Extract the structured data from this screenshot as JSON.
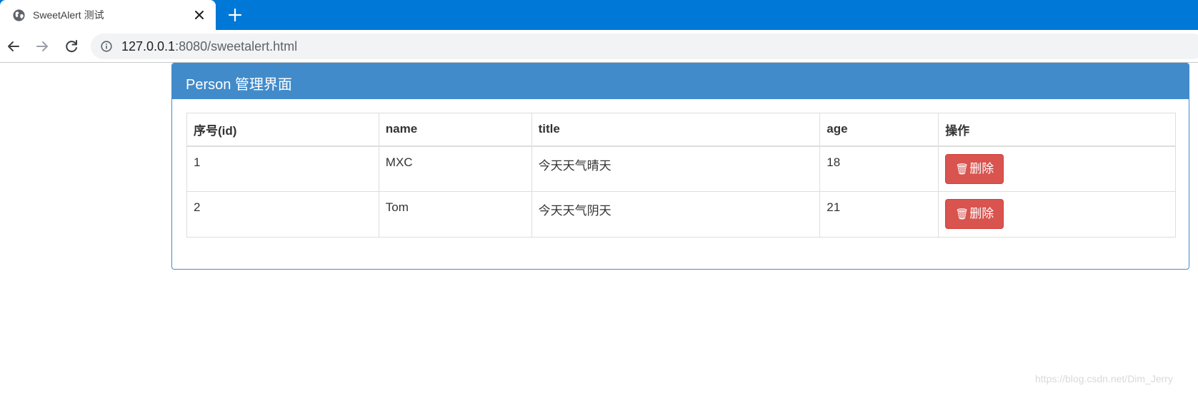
{
  "browser": {
    "tab_title": "SweetAlert 测试",
    "url_host": "127.0.0.1",
    "url_rest": ":8080/sweetalert.html"
  },
  "panel": {
    "title": "Person 管理界面"
  },
  "table": {
    "headers": [
      "序号(id)",
      "name",
      "title",
      "age",
      "操作"
    ],
    "rows": [
      {
        "id": "1",
        "name": "MXC",
        "title": "今天天气晴天",
        "age": "18",
        "action_label": "删除"
      },
      {
        "id": "2",
        "name": "Tom",
        "title": "今天天气阴天",
        "age": "21",
        "action_label": "删除"
      }
    ]
  },
  "watermark": "https://blog.csdn.net/Dim_Jerry",
  "colors": {
    "tabstrip": "#0078d7",
    "panel_primary": "#428bca",
    "danger": "#d9534f"
  },
  "icons": {
    "favicon": "globe-icon",
    "tab_close": "close-icon",
    "new_tab": "plus-icon",
    "back": "arrow-left-icon",
    "forward": "arrow-right-icon",
    "reload": "reload-icon",
    "site_info": "info-icon",
    "delete": "trash-icon"
  }
}
